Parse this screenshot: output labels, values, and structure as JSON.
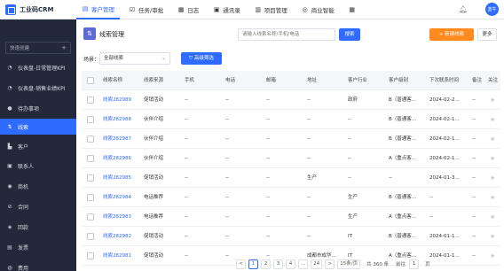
{
  "app": {
    "logo_text": "工业码CRM",
    "avatar_text": "蓝牛"
  },
  "topnav": [
    {
      "label": "客户管理",
      "icon": "customer-icon",
      "active": true
    },
    {
      "label": "任务/审批",
      "icon": "task-icon"
    },
    {
      "label": "日志",
      "icon": "log-icon"
    },
    {
      "label": "通讯录",
      "icon": "contacts-icon"
    },
    {
      "label": "项目管理",
      "icon": "project-icon"
    },
    {
      "label": "商业智能",
      "icon": "bi-icon"
    }
  ],
  "sidebar": {
    "quick_create": "快速创建",
    "quick_create_plus": "+",
    "items": [
      {
        "label": "仪表盘-日常管理KPI",
        "icon": "dashboard-icon"
      },
      {
        "label": "仪表盘-销售业绩KPI",
        "icon": "dashboard-icon"
      },
      {
        "label": "待办事项",
        "icon": "todo-icon"
      },
      {
        "label": "线索",
        "icon": "clue-icon",
        "active": true
      },
      {
        "label": "客户",
        "icon": "customer-icon"
      },
      {
        "label": "联系人",
        "icon": "contact-icon"
      },
      {
        "label": "商机",
        "icon": "opportunity-icon"
      },
      {
        "label": "合同",
        "icon": "contract-icon"
      },
      {
        "label": "回款",
        "icon": "payment-icon"
      },
      {
        "label": "发票",
        "icon": "invoice-icon"
      },
      {
        "label": "费用",
        "icon": "expense-icon"
      }
    ]
  },
  "header": {
    "title": "线索管理",
    "search_placeholder": "请输入线索名称/手机/电话",
    "search_label": "搜索",
    "new_label": "+ 新建线索",
    "more_label": "更多"
  },
  "filter": {
    "scene_label": "场景：",
    "scene_value": "全部线索",
    "advanced_label": "高级筛选"
  },
  "table": {
    "columns": [
      "线索名称",
      "线索来源",
      "手机",
      "电话",
      "邮箱",
      "地址",
      "客户行业",
      "客户级别",
      "下次联系时间",
      "备注",
      "关注"
    ],
    "rows": [
      [
        "线索282989",
        "促销活动",
        "--",
        "--",
        "--",
        "--",
        "政府",
        "B（普通客...",
        "2024-02-2...",
        "--"
      ],
      [
        "线索282988",
        "伙伴介绍",
        "--",
        "--",
        "--",
        "--",
        "--",
        "B（普通客...",
        "2024-02-1...",
        "--"
      ],
      [
        "线索282987",
        "伙伴介绍",
        "--",
        "--",
        "--",
        "--",
        "--",
        "B（普通客...",
        "2024-02-1...",
        "--"
      ],
      [
        "线索282986",
        "伙伴介绍",
        "--",
        "--",
        "--",
        "--",
        "--",
        "A（重点客...",
        "2024-02-1...",
        "--"
      ],
      [
        "线索282985",
        "促销活动",
        "--",
        "--",
        "--",
        "生产",
        "--",
        "--",
        "2024-01-3...",
        "--"
      ],
      [
        "线索282984",
        "电话推荐",
        "--",
        "--",
        "--",
        "--",
        "生产",
        "B（普通客...",
        "--",
        "--"
      ],
      [
        "线索282983",
        "电话推荐",
        "--",
        "--",
        "--",
        "--",
        "生产",
        "A（重点客...",
        "--",
        "--"
      ],
      [
        "线索282982",
        "促销活动",
        "--",
        "--",
        "--",
        "--",
        "IT",
        "B（普通客...",
        "2024-01-1...",
        "--"
      ],
      [
        "线索282981",
        "促销活动",
        "--",
        "--",
        "--",
        "成都市成华...",
        "IT",
        "A（重点客...",
        "2024-01-1...",
        "--"
      ]
    ]
  },
  "pager": {
    "prev": "<",
    "pages": [
      "1",
      "2",
      "3",
      "4",
      "...",
      "24"
    ],
    "next": ">",
    "page_size": "15条/页",
    "total": "共 360 条",
    "goto_label": "前往",
    "goto_value": "1",
    "page_suffix": "页"
  }
}
